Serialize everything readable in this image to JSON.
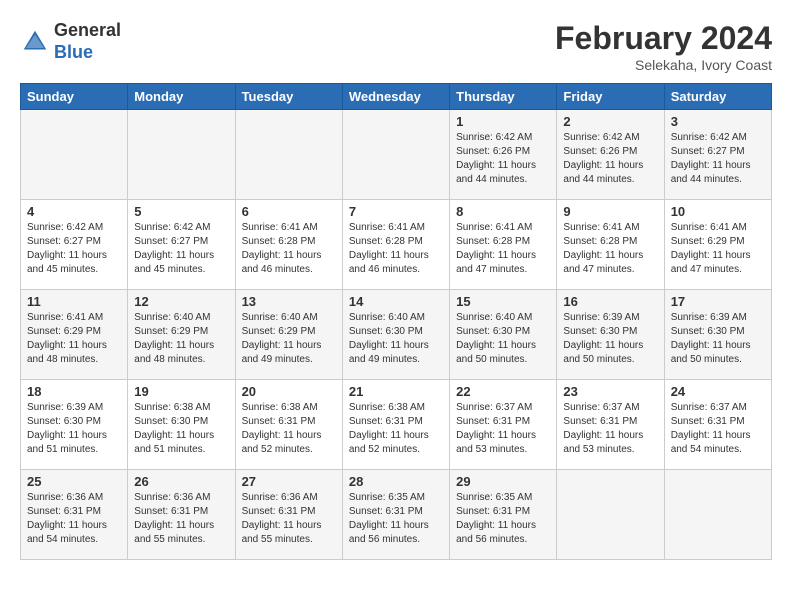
{
  "header": {
    "logo_general": "General",
    "logo_blue": "Blue",
    "main_title": "February 2024",
    "subtitle": "Selekaha, Ivory Coast"
  },
  "calendar": {
    "days_of_week": [
      "Sunday",
      "Monday",
      "Tuesday",
      "Wednesday",
      "Thursday",
      "Friday",
      "Saturday"
    ],
    "weeks": [
      [
        {
          "day": "",
          "info": ""
        },
        {
          "day": "",
          "info": ""
        },
        {
          "day": "",
          "info": ""
        },
        {
          "day": "",
          "info": ""
        },
        {
          "day": "1",
          "info": "Sunrise: 6:42 AM\nSunset: 6:26 PM\nDaylight: 11 hours and 44 minutes."
        },
        {
          "day": "2",
          "info": "Sunrise: 6:42 AM\nSunset: 6:26 PM\nDaylight: 11 hours and 44 minutes."
        },
        {
          "day": "3",
          "info": "Sunrise: 6:42 AM\nSunset: 6:27 PM\nDaylight: 11 hours and 44 minutes."
        }
      ],
      [
        {
          "day": "4",
          "info": "Sunrise: 6:42 AM\nSunset: 6:27 PM\nDaylight: 11 hours and 45 minutes."
        },
        {
          "day": "5",
          "info": "Sunrise: 6:42 AM\nSunset: 6:27 PM\nDaylight: 11 hours and 45 minutes."
        },
        {
          "day": "6",
          "info": "Sunrise: 6:41 AM\nSunset: 6:28 PM\nDaylight: 11 hours and 46 minutes."
        },
        {
          "day": "7",
          "info": "Sunrise: 6:41 AM\nSunset: 6:28 PM\nDaylight: 11 hours and 46 minutes."
        },
        {
          "day": "8",
          "info": "Sunrise: 6:41 AM\nSunset: 6:28 PM\nDaylight: 11 hours and 47 minutes."
        },
        {
          "day": "9",
          "info": "Sunrise: 6:41 AM\nSunset: 6:28 PM\nDaylight: 11 hours and 47 minutes."
        },
        {
          "day": "10",
          "info": "Sunrise: 6:41 AM\nSunset: 6:29 PM\nDaylight: 11 hours and 47 minutes."
        }
      ],
      [
        {
          "day": "11",
          "info": "Sunrise: 6:41 AM\nSunset: 6:29 PM\nDaylight: 11 hours and 48 minutes."
        },
        {
          "day": "12",
          "info": "Sunrise: 6:40 AM\nSunset: 6:29 PM\nDaylight: 11 hours and 48 minutes."
        },
        {
          "day": "13",
          "info": "Sunrise: 6:40 AM\nSunset: 6:29 PM\nDaylight: 11 hours and 49 minutes."
        },
        {
          "day": "14",
          "info": "Sunrise: 6:40 AM\nSunset: 6:30 PM\nDaylight: 11 hours and 49 minutes."
        },
        {
          "day": "15",
          "info": "Sunrise: 6:40 AM\nSunset: 6:30 PM\nDaylight: 11 hours and 50 minutes."
        },
        {
          "day": "16",
          "info": "Sunrise: 6:39 AM\nSunset: 6:30 PM\nDaylight: 11 hours and 50 minutes."
        },
        {
          "day": "17",
          "info": "Sunrise: 6:39 AM\nSunset: 6:30 PM\nDaylight: 11 hours and 50 minutes."
        }
      ],
      [
        {
          "day": "18",
          "info": "Sunrise: 6:39 AM\nSunset: 6:30 PM\nDaylight: 11 hours and 51 minutes."
        },
        {
          "day": "19",
          "info": "Sunrise: 6:38 AM\nSunset: 6:30 PM\nDaylight: 11 hours and 51 minutes."
        },
        {
          "day": "20",
          "info": "Sunrise: 6:38 AM\nSunset: 6:31 PM\nDaylight: 11 hours and 52 minutes."
        },
        {
          "day": "21",
          "info": "Sunrise: 6:38 AM\nSunset: 6:31 PM\nDaylight: 11 hours and 52 minutes."
        },
        {
          "day": "22",
          "info": "Sunrise: 6:37 AM\nSunset: 6:31 PM\nDaylight: 11 hours and 53 minutes."
        },
        {
          "day": "23",
          "info": "Sunrise: 6:37 AM\nSunset: 6:31 PM\nDaylight: 11 hours and 53 minutes."
        },
        {
          "day": "24",
          "info": "Sunrise: 6:37 AM\nSunset: 6:31 PM\nDaylight: 11 hours and 54 minutes."
        }
      ],
      [
        {
          "day": "25",
          "info": "Sunrise: 6:36 AM\nSunset: 6:31 PM\nDaylight: 11 hours and 54 minutes."
        },
        {
          "day": "26",
          "info": "Sunrise: 6:36 AM\nSunset: 6:31 PM\nDaylight: 11 hours and 55 minutes."
        },
        {
          "day": "27",
          "info": "Sunrise: 6:36 AM\nSunset: 6:31 PM\nDaylight: 11 hours and 55 minutes."
        },
        {
          "day": "28",
          "info": "Sunrise: 6:35 AM\nSunset: 6:31 PM\nDaylight: 11 hours and 56 minutes."
        },
        {
          "day": "29",
          "info": "Sunrise: 6:35 AM\nSunset: 6:31 PM\nDaylight: 11 hours and 56 minutes."
        },
        {
          "day": "",
          "info": ""
        },
        {
          "day": "",
          "info": ""
        }
      ]
    ]
  }
}
